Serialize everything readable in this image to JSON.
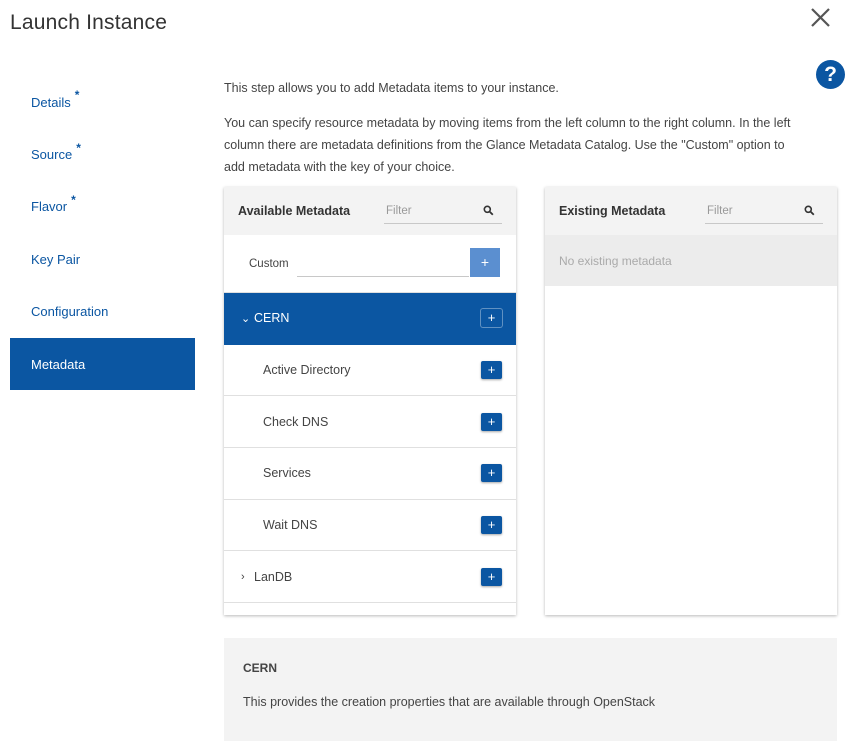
{
  "dialog": {
    "title": "Launch Instance",
    "close_icon": "close-icon",
    "help_label": "?"
  },
  "nav": {
    "items": [
      {
        "label": "Details",
        "required": "*"
      },
      {
        "label": "Source",
        "required": "*"
      },
      {
        "label": "Flavor",
        "required": "*"
      },
      {
        "label": "Key Pair",
        "required": ""
      },
      {
        "label": "Configuration",
        "required": ""
      },
      {
        "label": "Metadata",
        "required": "",
        "active": true
      }
    ]
  },
  "intro": {
    "line1": "This step allows you to add Metadata items to your instance.",
    "line2": "You can specify resource metadata by moving items from the left column to the right column. In the left column there are metadata definitions from the Glance Metadata Catalog. Use the \"Custom\" option to add metadata with the key of your choice."
  },
  "available": {
    "title": "Available Metadata",
    "filter_placeholder": "Filter",
    "custom_label": "Custom",
    "custom_value": "",
    "add_symbol": "+",
    "tree": [
      {
        "label": "CERN",
        "type": "parent",
        "expanded": true,
        "selected": true,
        "chevron": "⌄"
      },
      {
        "label": "Active Directory",
        "type": "child"
      },
      {
        "label": "Check DNS",
        "type": "child"
      },
      {
        "label": "Services",
        "type": "child"
      },
      {
        "label": "Wait DNS",
        "type": "child"
      },
      {
        "label": "LanDB",
        "type": "parent",
        "expanded": false,
        "chevron": "›"
      }
    ]
  },
  "existing": {
    "title": "Existing Metadata",
    "filter_placeholder": "Filter",
    "empty_text": "No existing metadata"
  },
  "detail": {
    "title": "CERN",
    "description": "This provides the creation properties that are available through OpenStack"
  },
  "colors": {
    "primary": "#0b56a2",
    "custom_add": "#5b8fd0",
    "panel_head": "#f3f3f3"
  }
}
